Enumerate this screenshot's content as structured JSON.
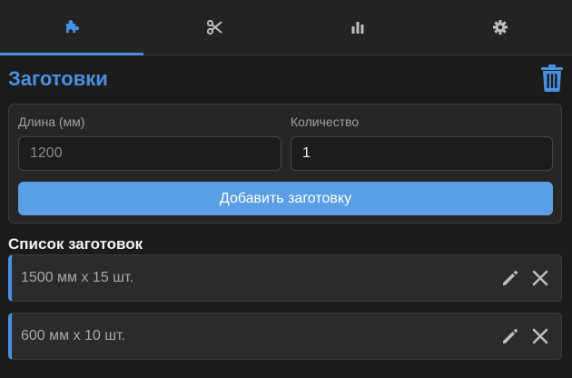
{
  "tabs": [
    {
      "icon": "puzzle-icon",
      "active": true
    },
    {
      "icon": "scissors-icon",
      "active": false
    },
    {
      "icon": "bar-chart-icon",
      "active": false
    },
    {
      "icon": "gear-icon",
      "active": false
    }
  ],
  "colors": {
    "accent": "#4a90e2",
    "button": "#5a9fe6",
    "background": "#1b1b1b"
  },
  "header": {
    "title": "Заготовки",
    "clear_icon": "trash-icon"
  },
  "form": {
    "length_label": "Длина (мм)",
    "length_placeholder": "1200",
    "length_value": "",
    "quantity_label": "Количество",
    "quantity_value": "1",
    "add_button": "Добавить заготовку"
  },
  "list": {
    "title": "Список заготовок",
    "items": [
      {
        "text": "1500 мм x 15 шт.",
        "edit_icon": "pencil-icon",
        "delete_icon": "close-icon"
      },
      {
        "text": "600 мм x 10 шт.",
        "edit_icon": "pencil-icon",
        "delete_icon": "close-icon"
      }
    ]
  }
}
